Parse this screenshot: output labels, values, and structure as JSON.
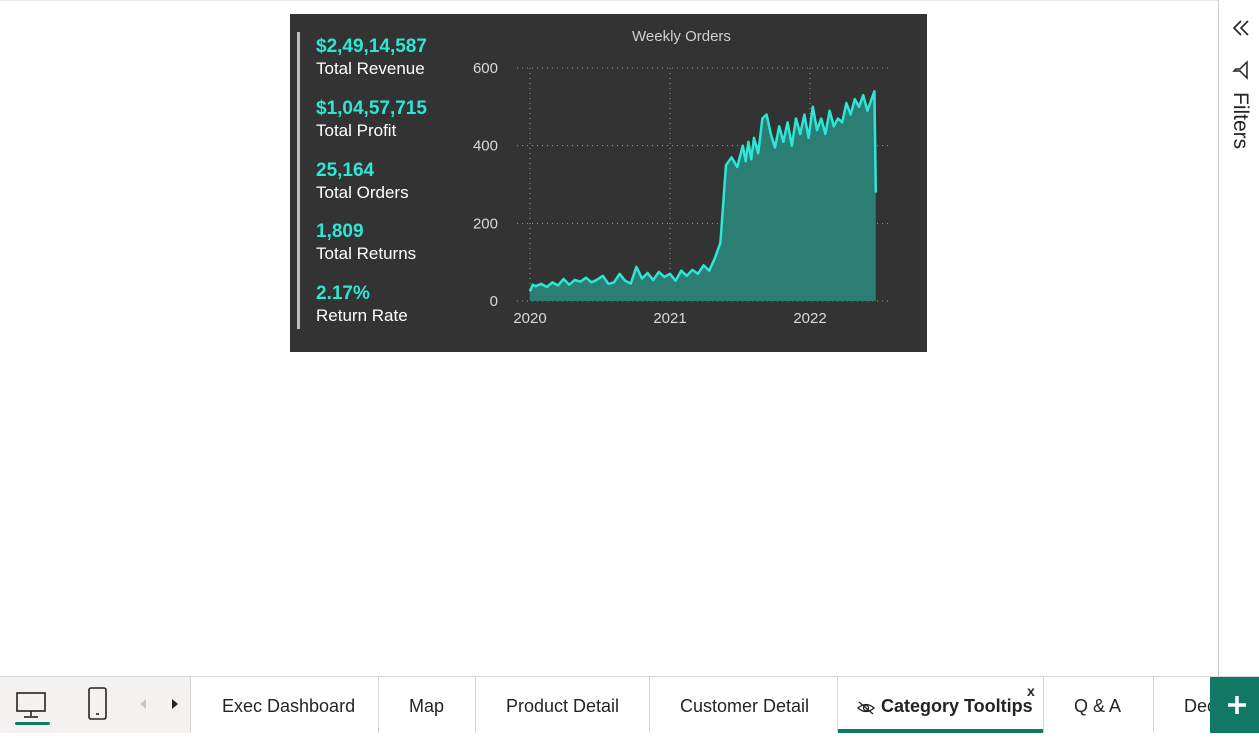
{
  "kpis": [
    {
      "value": "$2,49,14,587",
      "label": "Total Revenue"
    },
    {
      "value": "$1,04,57,715",
      "label": "Total Profit"
    },
    {
      "value": "25,164",
      "label": "Total Orders"
    },
    {
      "value": "1,809",
      "label": "Total Returns"
    },
    {
      "value": "2.17%",
      "label": "Return Rate"
    }
  ],
  "chart_data": {
    "type": "area",
    "title": "Weekly Orders",
    "xlabel": "",
    "ylabel": "",
    "ylim": [
      0,
      600
    ],
    "yticks": [
      "0",
      "200",
      "400",
      "600"
    ],
    "xticks": [
      "2020",
      "2021",
      "2022"
    ],
    "grid": true,
    "colors": {
      "line": "#2ee6d6",
      "fill": "#2a7e74"
    },
    "x": [
      2020.0,
      2020.02,
      2020.04,
      2020.08,
      2020.12,
      2020.16,
      2020.2,
      2020.24,
      2020.28,
      2020.32,
      2020.36,
      2020.4,
      2020.44,
      2020.48,
      2020.52,
      2020.56,
      2020.6,
      2020.64,
      2020.68,
      2020.72,
      2020.76,
      2020.8,
      2020.84,
      2020.88,
      2020.92,
      2020.96,
      2021.0,
      2021.04,
      2021.08,
      2021.12,
      2021.16,
      2021.2,
      2021.24,
      2021.28,
      2021.32,
      2021.36,
      2021.4,
      2021.44,
      2021.48,
      2021.52,
      2021.54,
      2021.56,
      2021.58,
      2021.6,
      2021.63,
      2021.66,
      2021.69,
      2021.72,
      2021.75,
      2021.78,
      2021.81,
      2021.84,
      2021.87,
      2021.9,
      2021.93,
      2021.96,
      2021.99,
      2022.02,
      2022.05,
      2022.08,
      2022.11,
      2022.14,
      2022.17,
      2022.2,
      2022.23,
      2022.26,
      2022.29,
      2022.32,
      2022.35,
      2022.38,
      2022.41,
      2022.44,
      2022.46,
      2022.47
    ],
    "values": [
      25,
      42,
      38,
      44,
      36,
      48,
      40,
      57,
      42,
      54,
      50,
      60,
      48,
      55,
      65,
      44,
      48,
      70,
      52,
      45,
      88,
      58,
      72,
      54,
      75,
      62,
      70,
      52,
      78,
      65,
      80,
      70,
      92,
      78,
      110,
      150,
      350,
      370,
      345,
      400,
      360,
      410,
      365,
      420,
      380,
      470,
      480,
      430,
      395,
      450,
      410,
      460,
      400,
      470,
      430,
      480,
      420,
      500,
      440,
      470,
      430,
      490,
      450,
      470,
      460,
      510,
      480,
      520,
      500,
      530,
      490,
      520,
      540,
      280
    ]
  },
  "filters": {
    "label": "Filters",
    "collapse_icon": "double-chevron-left-icon",
    "filter_icon": "funnel-icon"
  },
  "view_icons": [
    "desktop-icon",
    "phone-icon"
  ],
  "tabs": [
    {
      "label": "Exec Dashboard"
    },
    {
      "label": "Map"
    },
    {
      "label": "Product Detail"
    },
    {
      "label": "Customer Detail"
    },
    {
      "label": "Category Tooltips",
      "active": true,
      "hidden_icon": "eye-slash-icon",
      "close": "x"
    },
    {
      "label": "Q & A"
    },
    {
      "label": "Dec"
    }
  ],
  "add_page_icon": "plus-icon"
}
